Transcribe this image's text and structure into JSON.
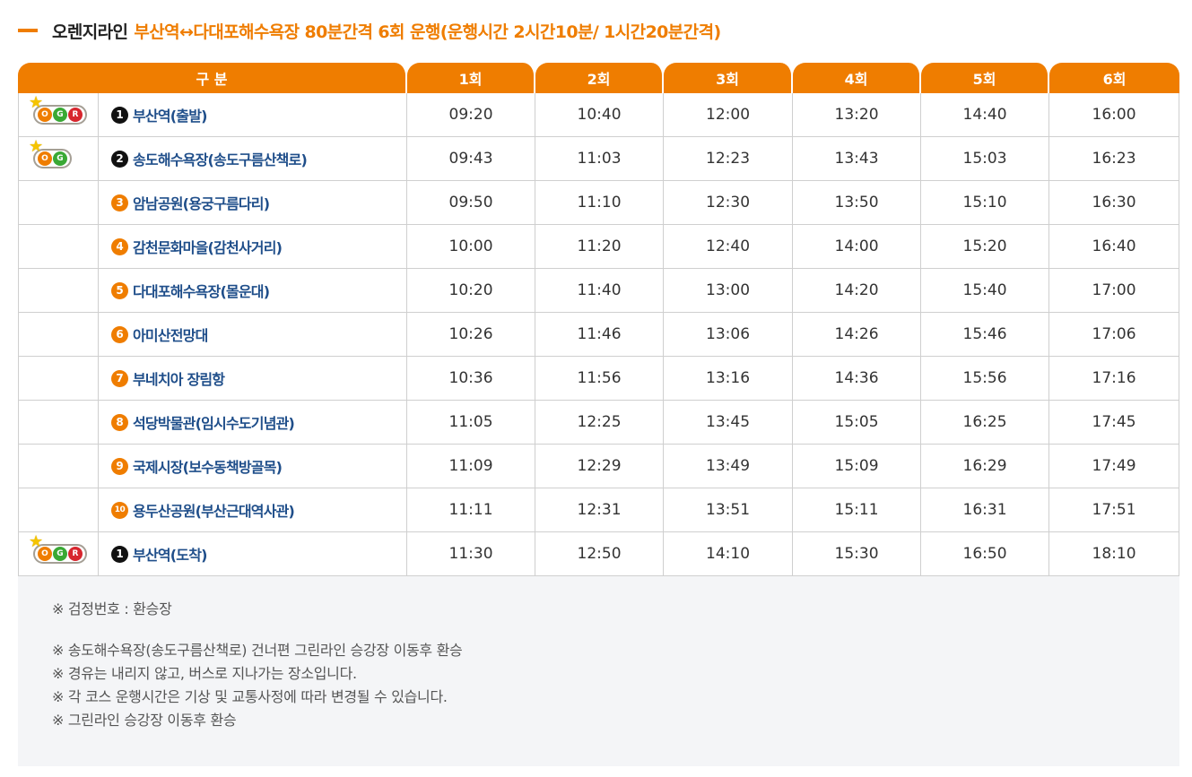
{
  "header": {
    "title": "오렌지라인",
    "subtitle": "부산역↔다대포해수욕장 80분간격 6회 운행(운행시간 2시간10분/ 1시간20분간격)"
  },
  "table": {
    "columns": [
      "구 분",
      "1회",
      "2회",
      "3회",
      "4회",
      "5회",
      "6회"
    ],
    "rows": [
      {
        "num": "1",
        "style": "black",
        "name": "부산역(출발)",
        "badge": [
          "O",
          "G",
          "R"
        ],
        "times": [
          "09:20",
          "10:40",
          "12:00",
          "13:20",
          "14:40",
          "16:00"
        ]
      },
      {
        "num": "2",
        "style": "black",
        "name": "송도해수욕장(송도구름산책로)",
        "badge": [
          "O",
          "G"
        ],
        "times": [
          "09:43",
          "11:03",
          "12:23",
          "13:43",
          "15:03",
          "16:23"
        ]
      },
      {
        "num": "3",
        "style": "orange",
        "name": "암남공원(용궁구름다리)",
        "badge": [],
        "times": [
          "09:50",
          "11:10",
          "12:30",
          "13:50",
          "15:10",
          "16:30"
        ]
      },
      {
        "num": "4",
        "style": "orange",
        "name": "감천문화마을(감천사거리)",
        "badge": [],
        "times": [
          "10:00",
          "11:20",
          "12:40",
          "14:00",
          "15:20",
          "16:40"
        ]
      },
      {
        "num": "5",
        "style": "orange",
        "name": "다대포해수욕장(몰운대)",
        "badge": [],
        "times": [
          "10:20",
          "11:40",
          "13:00",
          "14:20",
          "15:40",
          "17:00"
        ]
      },
      {
        "num": "6",
        "style": "orange",
        "name": "아미산전망대",
        "badge": [],
        "times": [
          "10:26",
          "11:46",
          "13:06",
          "14:26",
          "15:46",
          "17:06"
        ]
      },
      {
        "num": "7",
        "style": "orange",
        "name": "부네치아 장림항",
        "badge": [],
        "times": [
          "10:36",
          "11:56",
          "13:16",
          "14:36",
          "15:56",
          "17:16"
        ]
      },
      {
        "num": "8",
        "style": "orange",
        "name": "석당박물관(임시수도기념관)",
        "badge": [],
        "times": [
          "11:05",
          "12:25",
          "13:45",
          "15:05",
          "16:25",
          "17:45"
        ]
      },
      {
        "num": "9",
        "style": "orange",
        "name": "국제시장(보수동책방골목)",
        "badge": [],
        "times": [
          "11:09",
          "12:29",
          "13:49",
          "15:09",
          "16:29",
          "17:49"
        ]
      },
      {
        "num": "10",
        "style": "orange",
        "name": "용두산공원(부산근대역사관)",
        "badge": [],
        "times": [
          "11:11",
          "12:31",
          "13:51",
          "15:11",
          "16:31",
          "17:51"
        ]
      },
      {
        "num": "1",
        "style": "black",
        "name": "부산역(도착)",
        "badge": [
          "O",
          "G",
          "R"
        ],
        "times": [
          "11:30",
          "12:50",
          "14:10",
          "15:30",
          "16:50",
          "18:10"
        ]
      }
    ]
  },
  "notes": [
    "※ 검정번호 : 환승장",
    "※ 송도해수욕장(송도구름산책로) 건너편 그린라인 승강장 이동후 환승",
    "※ 경유는 내리지 않고, 버스로 지나가는 장소입니다.",
    "※ 각 코스 운행시간은 기상 및 교통사정에 따라 변경될 수 있습니다.",
    "※ 그린라인 승강장 이동후 환승"
  ],
  "colors": {
    "accent": "#ef7d00",
    "stop_text": "#1f4e8a",
    "orange_line": "#ef7d00",
    "green_line": "#3aa935",
    "red_line": "#d7262e"
  }
}
